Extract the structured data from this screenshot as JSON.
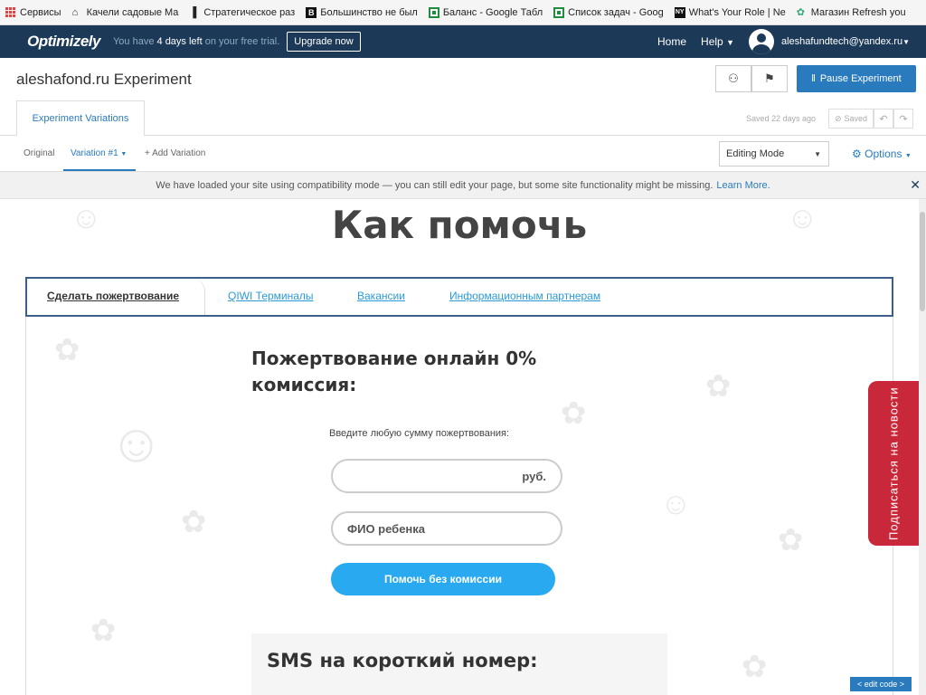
{
  "browser": {
    "bookmarks": [
      {
        "label": "Сервисы",
        "icon": "apps-icon"
      },
      {
        "label": "Качели садовые Ma",
        "icon": "home-icon"
      },
      {
        "label": "Стратегическое раз",
        "icon": "book-icon"
      },
      {
        "label": "Большинство не был",
        "icon": "b-icon"
      },
      {
        "label": "Баланс - Google Табл",
        "icon": "sheets-icon"
      },
      {
        "label": "Список задач - Goog",
        "icon": "sheets-icon"
      },
      {
        "label": "What's Your Role | Ne",
        "icon": "nyt-icon"
      },
      {
        "label": "Магазин Refresh you",
        "icon": "shop-icon"
      }
    ]
  },
  "topnav": {
    "logo": "Optimizely",
    "trial_prefix": "You have",
    "trial_days": "4 days left",
    "trial_suffix": "on your free trial.",
    "upgrade_label": "Upgrade now",
    "home_label": "Home",
    "help_label": "Help",
    "user_email": "aleshafundtech@yandex.ru"
  },
  "experiment": {
    "title": "aleshafond.ru Experiment",
    "pause_label": "Pause Experiment",
    "tab_label": "Experiment Variations",
    "saved_text": "Saved 22 days ago",
    "saved_button": "Saved"
  },
  "variation_bar": {
    "original": "Original",
    "variation1": "Variation #1",
    "add_variation": "+ Add Variation",
    "editing_mode": "Editing Mode",
    "options": "Options"
  },
  "notice": {
    "text": "We have loaded your site using compatibility mode — you can still edit your page, but some site functionality might be missing.",
    "link": "Learn More."
  },
  "site": {
    "heading": "Как помочь",
    "tabs": [
      "Сделать пожертвование",
      "QIWI Терминалы",
      "Вакансии",
      "Информационным партнерам"
    ],
    "donation_title": "Пожертвование онлайн 0% комиссия:",
    "amount_label": "Введите любую сумму пожертвования:",
    "amount_suffix": "руб.",
    "name_placeholder": "ФИО ребенка",
    "help_button": "Помочь без комиссии",
    "sms_title": "SMS на короткий номер:",
    "subscribe_text": "Подписаться на новости",
    "edit_code": "< edit code >"
  }
}
